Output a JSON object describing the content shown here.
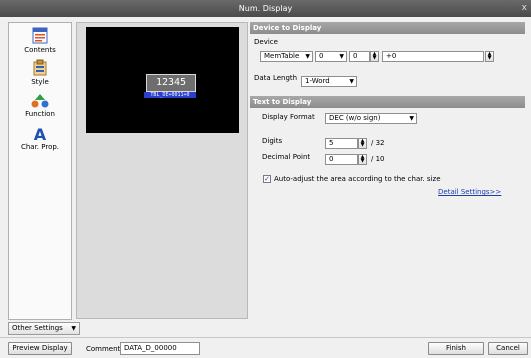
{
  "window": {
    "title": "Num. Display",
    "close": "x"
  },
  "sidebar": {
    "items": [
      {
        "label": "Contents",
        "icon": "contents-icon"
      },
      {
        "label": "Style",
        "icon": "style-icon"
      },
      {
        "label": "Function",
        "icon": "function-icon"
      },
      {
        "label": "Char. Prop.",
        "icon": "char-prop-icon"
      }
    ],
    "other_settings": "Other Settings"
  },
  "preview": {
    "value": "12345",
    "device_label": "TBL_DE+0011+0"
  },
  "device_section": {
    "header": "Device to Display",
    "device_label": "Device",
    "device_type": "MemTable",
    "device_no": "0",
    "offset_a": "0",
    "offset_b": "+0",
    "data_length_label": "Data Length",
    "data_length": "1-Word"
  },
  "text_section": {
    "header": "Text to Display",
    "display_format_label": "Display Format",
    "display_format": "DEC (w/o sign)",
    "digits_label": "Digits",
    "digits": "5",
    "digits_max": "/ 32",
    "decimal_label": "Decimal Point",
    "decimal": "0",
    "decimal_max": "/ 10",
    "auto_adjust": "Auto-adjust the area according to the char. size",
    "auto_adjust_checked": true,
    "detail_link": "Detail Settings>>"
  },
  "bottom": {
    "preview_button": "Preview Display",
    "comment_label": "Comment",
    "comment_value": "DATA_D_00000",
    "finish": "Finish",
    "cancel": "Cancel"
  }
}
